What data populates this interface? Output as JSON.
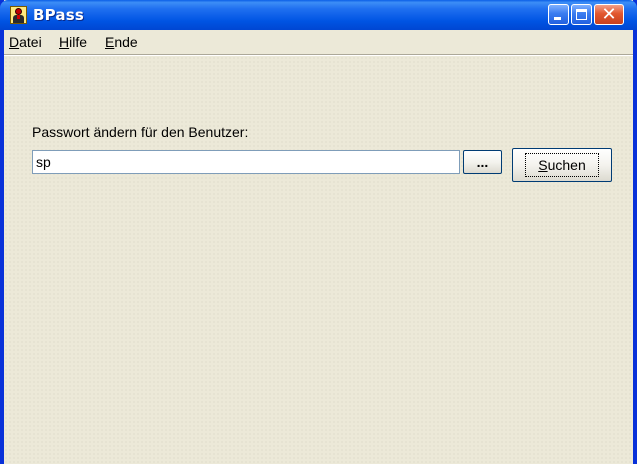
{
  "window": {
    "title": "BPass",
    "controls": {
      "minimize_icon": "minimize-icon",
      "maximize_icon": "maximize-icon",
      "close_icon": "close-icon",
      "close_glyph": "✕"
    }
  },
  "menubar": {
    "items": [
      {
        "label_mnemonic": "D",
        "label_rest": "atei"
      },
      {
        "label_mnemonic": "H",
        "label_rest": "ilfe"
      },
      {
        "label_mnemonic": "E",
        "label_rest": "nde"
      }
    ]
  },
  "form": {
    "label": "Passwort ändern für den Benutzer:",
    "user_value": "sp",
    "browse_label": "...",
    "search_mnemonic": "S",
    "search_rest": "uchen"
  },
  "colors": {
    "titlebar": "#0054e3",
    "face": "#ece9d8",
    "close": "#e2572f",
    "input_border": "#7f9db9"
  }
}
